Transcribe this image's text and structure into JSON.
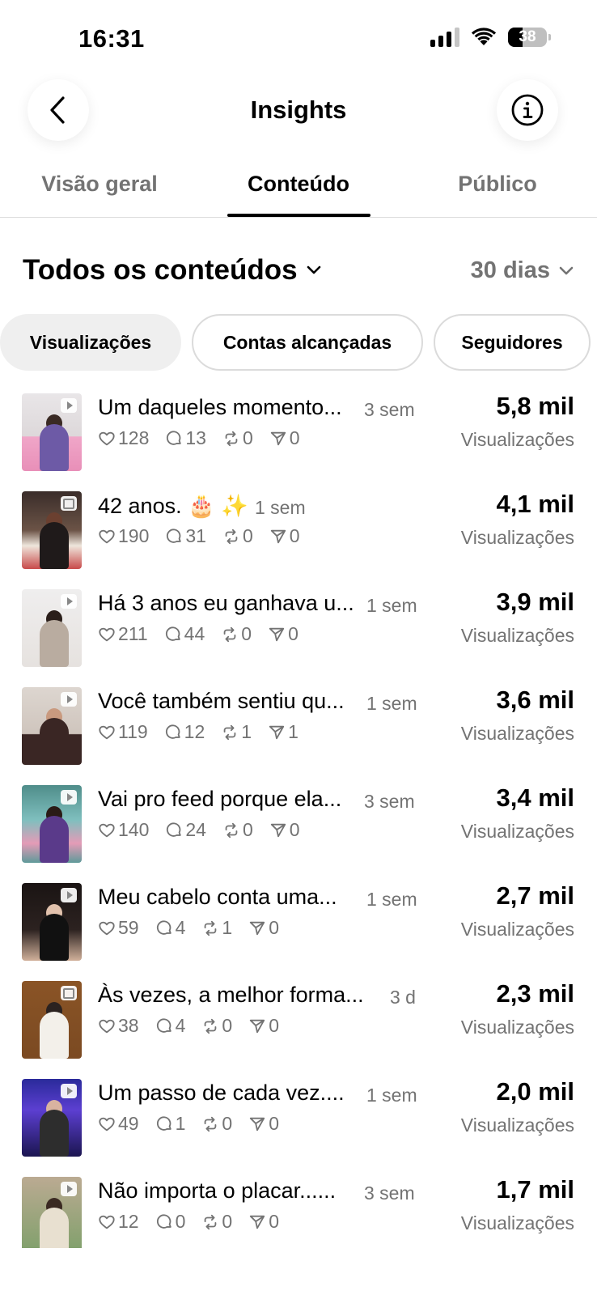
{
  "status_bar": {
    "time": "16:31",
    "battery": "38",
    "icons": [
      "signal-icon",
      "wifi-icon",
      "battery-icon"
    ]
  },
  "header": {
    "title": "Insights",
    "back_icon": "chevron-left-icon",
    "info_icon": "info-icon"
  },
  "tabs": [
    {
      "label": "Visão geral",
      "active": false
    },
    {
      "label": "Conteúdo",
      "active": true
    },
    {
      "label": "Público",
      "active": false
    }
  ],
  "filters": {
    "content_selector": "Todos os conteúdos",
    "period": "30 dias"
  },
  "chips": [
    {
      "label": "Visualizações",
      "selected": true
    },
    {
      "label": "Contas alcançadas",
      "selected": false
    },
    {
      "label": "Seguidores",
      "selected": false
    }
  ],
  "posts": [
    {
      "caption": "Um daqueles momento...",
      "age": "3 sem",
      "likes": "128",
      "comments": "13",
      "reposts": "0",
      "shares": "0",
      "value": "5,8 mil",
      "metric": "Visualizações",
      "thumb": "reel"
    },
    {
      "caption": "42 anos. 🎂 ✨",
      "age": "1 sem",
      "likes": "190",
      "comments": "31",
      "reposts": "0",
      "shares": "0",
      "value": "4,1 mil",
      "metric": "Visualizações",
      "thumb": "carousel"
    },
    {
      "caption": "Há 3 anos eu ganhava u...",
      "age": "1 sem",
      "likes": "211",
      "comments": "44",
      "reposts": "0",
      "shares": "0",
      "value": "3,9 mil",
      "metric": "Visualizações",
      "thumb": "reel"
    },
    {
      "caption": "Você também sentiu qu...",
      "age": "1 sem",
      "likes": "119",
      "comments": "12",
      "reposts": "1",
      "shares": "1",
      "value": "3,6 mil",
      "metric": "Visualizações",
      "thumb": "reel"
    },
    {
      "caption": "Vai pro feed porque ela...",
      "age": "3 sem",
      "likes": "140",
      "comments": "24",
      "reposts": "0",
      "shares": "0",
      "value": "3,4 mil",
      "metric": "Visualizações",
      "thumb": "reel"
    },
    {
      "caption": "Meu cabelo conta uma...",
      "age": "1 sem",
      "likes": "59",
      "comments": "4",
      "reposts": "1",
      "shares": "0",
      "value": "2,7 mil",
      "metric": "Visualizações",
      "thumb": "reel"
    },
    {
      "caption": "Às vezes, a melhor forma...",
      "age": "3 d",
      "likes": "38",
      "comments": "4",
      "reposts": "0",
      "shares": "0",
      "value": "2,3 mil",
      "metric": "Visualizações",
      "thumb": "carousel"
    },
    {
      "caption": "Um passo de cada vez....",
      "age": "1 sem",
      "likes": "49",
      "comments": "1",
      "reposts": "0",
      "shares": "0",
      "value": "2,0 mil",
      "metric": "Visualizações",
      "thumb": "reel"
    },
    {
      "caption": "Não importa o placar......",
      "age": "3 sem",
      "likes": "12",
      "comments": "0",
      "reposts": "0",
      "shares": "0",
      "value": "1,7 mil",
      "metric": "Visualizações",
      "thumb": "reel"
    }
  ],
  "colors": {
    "text": "#000000",
    "secondary_text": "#737373",
    "chip_selected_bg": "#efefef",
    "chip_border": "#dbdbdb",
    "divider": "#dcdcdc"
  }
}
